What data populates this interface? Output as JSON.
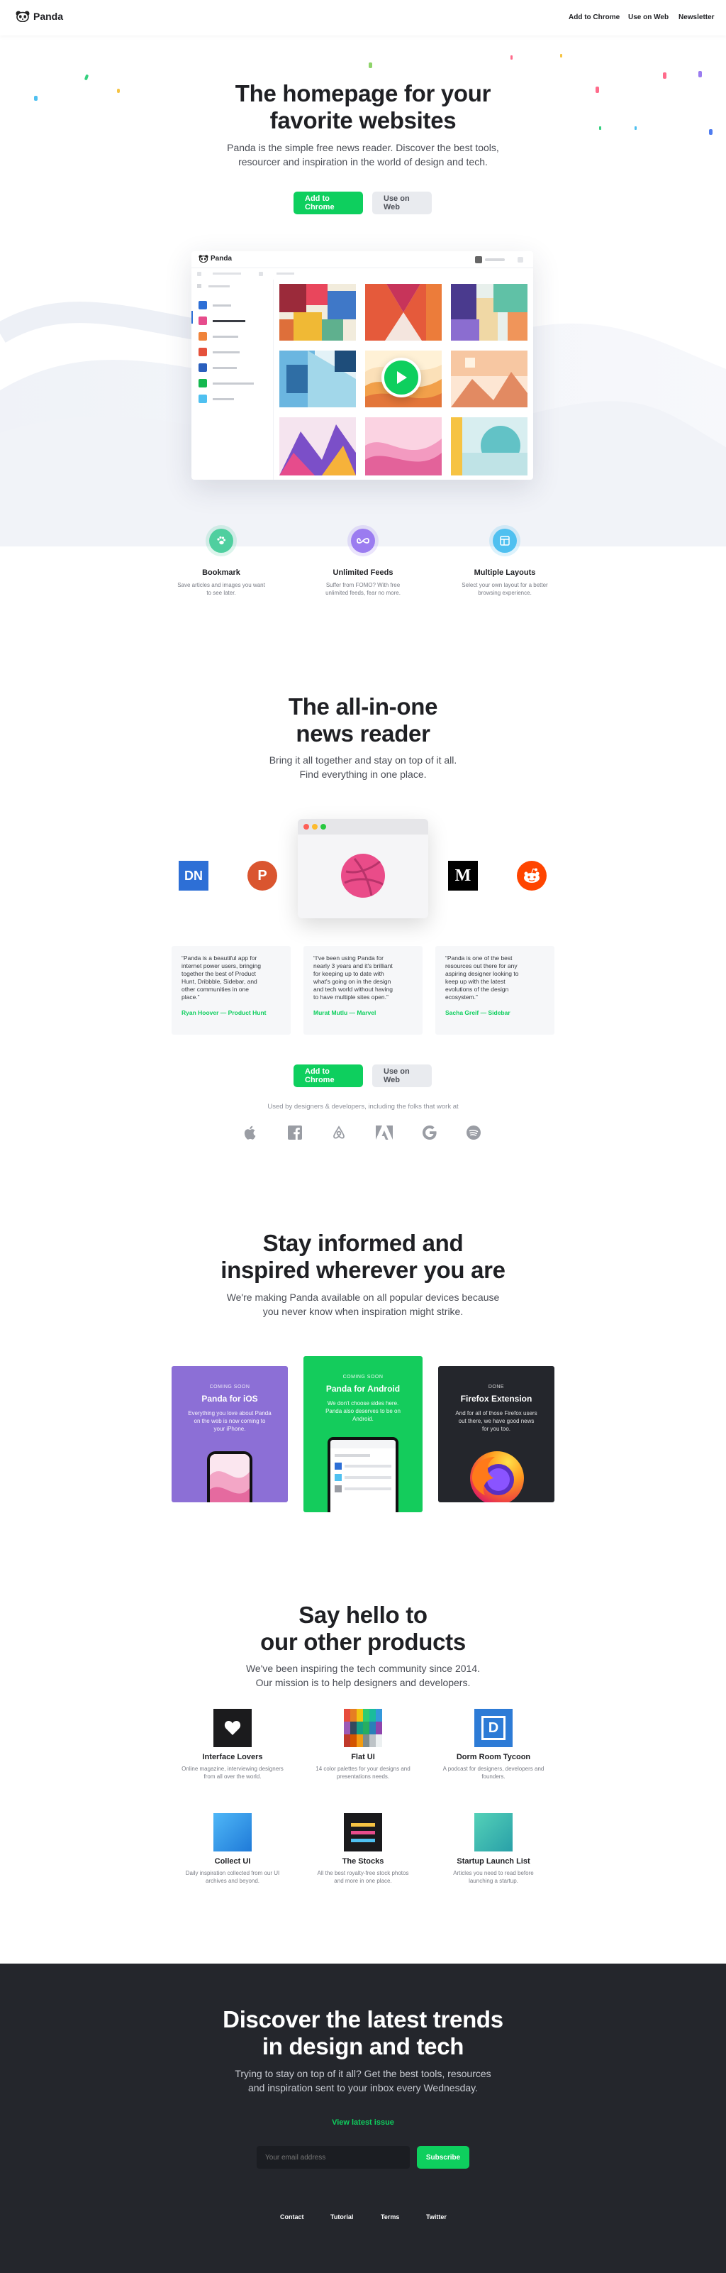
{
  "nav": {
    "brand": "Panda",
    "links": [
      "Add to Chrome",
      "Use on Web",
      "Newsletter"
    ]
  },
  "hero": {
    "title_line1": "The homepage for your",
    "title_line2": "favorite websites",
    "subtitle_line1": "Panda is the simple free news reader. Discover the best tools,",
    "subtitle_line2": "resourcer and inspiration in the world of design and tech.",
    "cta_primary": "Add to Chrome",
    "cta_secondary": "Use on Web"
  },
  "app_preview": {
    "brand": "Panda"
  },
  "features": [
    {
      "title": "Bookmark",
      "desc_line1": "Save articles and images you want",
      "desc_line2": "to see later.",
      "icon": "paw-icon",
      "color": "#4fcf9f"
    },
    {
      "title": "Unlimited Feeds",
      "desc_line1": "Suffer from FOMO? With free",
      "desc_line2": "unlimited feeds, fear no more.",
      "icon": "infinity-icon",
      "color": "#9b7cf0"
    },
    {
      "title": "Multiple Layouts",
      "desc_line1": "Select your own layout for a better",
      "desc_line2": "browsing experience.",
      "icon": "layout-icon",
      "color": "#4fc0f0"
    }
  ],
  "allinone": {
    "title_line1": "The all-in-one",
    "title_line2": "news reader",
    "subtitle_line1": "Bring it all together and stay on top of it all.",
    "subtitle_line2": "Find everything in one place.",
    "sources_left": [
      {
        "label": "DN",
        "icon": "designer-news-icon",
        "color": "#2d6fd6"
      },
      {
        "label": "P",
        "icon": "product-hunt-icon",
        "color": "#da552f"
      }
    ],
    "sources_right": [
      {
        "label": "M",
        "icon": "medium-icon",
        "color": "#000000"
      },
      {
        "label": "",
        "icon": "reddit-icon",
        "color": "#ff4500"
      }
    ]
  },
  "testimonials": [
    {
      "lines": [
        "“Panda is a beautiful app for",
        "internet power users, bringing",
        "together the best of Product",
        "Hunt, Dribbble, Sidebar, and",
        "other communities in one",
        "place.”"
      ],
      "author": "Ryan Hoover — Product Hunt"
    },
    {
      "lines": [
        "“I've been using Panda for",
        "nearly 3 years and it's brilliant",
        "for keeping up to date with",
        "what's going on in the design",
        "and tech world without having",
        "to have multiple sites open.”"
      ],
      "author": "Murat Mutlu — Marvel"
    },
    {
      "lines": [
        "“Panda is one of the best",
        "resources out there for any",
        "aspiring designer looking to",
        "keep up with the latest",
        "evolutions of the design",
        "ecosystem.”"
      ],
      "author": "Sacha Greif — Sidebar"
    }
  ],
  "cta2": {
    "primary": "Add to Chrome",
    "secondary": "Use on Web"
  },
  "used_by": {
    "text": "Used by designers & developers, including the folks that work at",
    "logos": [
      "apple-icon",
      "facebook-icon",
      "airbnb-icon",
      "adobe-icon",
      "google-icon",
      "spotify-icon"
    ]
  },
  "devices": {
    "title_line1": "Stay informed and",
    "title_line2": "inspired wherever you are",
    "subtitle_line1": "We're making Panda available on all popular devices because",
    "subtitle_line2": "you never know when inspiration might strike.",
    "cards": [
      {
        "tag": "COMING SOON",
        "title": "Panda for iOS",
        "desc": [
          "Everything you love about Panda",
          "on the web is now coming to",
          "your iPhone."
        ],
        "color": "#8c6fd6"
      },
      {
        "tag": "COMING SOON",
        "title": "Panda for Android",
        "desc": [
          "We don't choose sides here.",
          "Panda also deserves to be on",
          "Android."
        ],
        "color": "#14cc5c"
      },
      {
        "tag": "DONE",
        "title": "Firefox Extension",
        "desc": [
          "And for all of those Firefox users",
          "out there, we have good news",
          "for you too."
        ],
        "color": "#24262c"
      }
    ]
  },
  "products": {
    "title_line1": "Say hello to",
    "title_line2": "our other products",
    "subtitle_line1": "We've been inspiring the tech community since 2014.",
    "subtitle_line2": "Our mission is to help designers and developers.",
    "items": [
      {
        "title": "Interface Lovers",
        "desc_line1": "Online magazine, interviewing designers",
        "desc_line2": "from all over the world.",
        "icon": "heart-icon"
      },
      {
        "title": "Flat UI",
        "desc_line1": "14 color palettes for your designs and",
        "desc_line2": "presentations needs.",
        "icon": "palette-icon"
      },
      {
        "title": "Dorm Room Tycoon",
        "desc_line1": "A podcast for designers, developers and",
        "desc_line2": "founders.",
        "icon": "dorm-room-icon"
      },
      {
        "title": "Collect UI",
        "desc_line1": "Daily inspiration collected from our UI",
        "desc_line2": "archives and beyond.",
        "icon": "collect-ui-icon"
      },
      {
        "title": "The Stocks",
        "desc_line1": "All the best royalty-free stock photos",
        "desc_line2": "and more in one place.",
        "icon": "stocks-icon"
      },
      {
        "title": "Startup Launch List",
        "desc_line1": "Articles you need to read before",
        "desc_line2": "launching a startup.",
        "icon": "launch-list-icon"
      }
    ]
  },
  "newsletter": {
    "title_line1": "Discover the latest trends",
    "title_line2": "in design and tech",
    "subtitle_line1": "Trying to stay on top of it all? Get the best tools, resources",
    "subtitle_line2": "and inspiration sent to your inbox every Wednesday.",
    "link": "View latest issue",
    "placeholder": "Your email address",
    "button": "Subscribe"
  },
  "footer": {
    "links": [
      "Contact",
      "Tutorial",
      "Terms",
      "Twitter"
    ]
  }
}
